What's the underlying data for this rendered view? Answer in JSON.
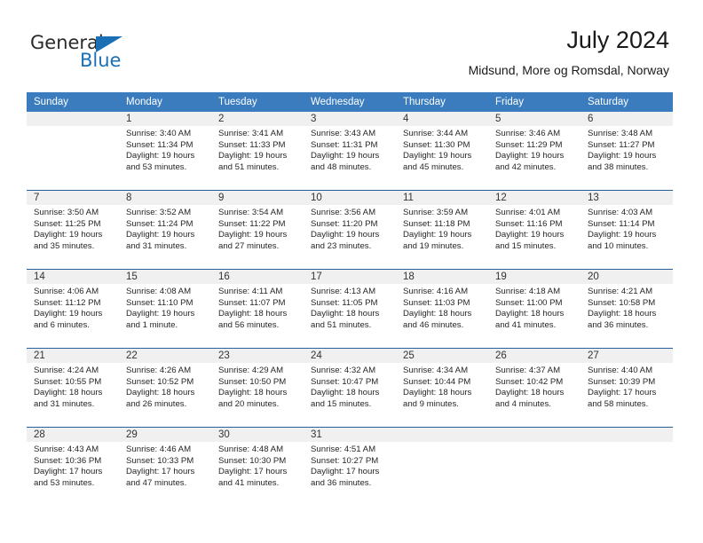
{
  "brand": {
    "name_part1": "General",
    "name_part2": "Blue"
  },
  "header": {
    "title": "July 2024",
    "subtitle": "Midsund, More og Romsdal, Norway"
  },
  "colors": {
    "header_blue": "#3a7cbe",
    "row_rule_blue": "#2a6099",
    "daynum_strip": "#f0f0f0",
    "brand_blue": "#1a6fb5"
  },
  "weekday_headers": [
    "Sunday",
    "Monday",
    "Tuesday",
    "Wednesday",
    "Thursday",
    "Friday",
    "Saturday"
  ],
  "weeks": [
    [
      {
        "day": "",
        "sunrise": "",
        "sunset": "",
        "daylight1": "",
        "daylight2": ""
      },
      {
        "day": "1",
        "sunrise": "Sunrise: 3:40 AM",
        "sunset": "Sunset: 11:34 PM",
        "daylight1": "Daylight: 19 hours",
        "daylight2": "and 53 minutes."
      },
      {
        "day": "2",
        "sunrise": "Sunrise: 3:41 AM",
        "sunset": "Sunset: 11:33 PM",
        "daylight1": "Daylight: 19 hours",
        "daylight2": "and 51 minutes."
      },
      {
        "day": "3",
        "sunrise": "Sunrise: 3:43 AM",
        "sunset": "Sunset: 11:31 PM",
        "daylight1": "Daylight: 19 hours",
        "daylight2": "and 48 minutes."
      },
      {
        "day": "4",
        "sunrise": "Sunrise: 3:44 AM",
        "sunset": "Sunset: 11:30 PM",
        "daylight1": "Daylight: 19 hours",
        "daylight2": "and 45 minutes."
      },
      {
        "day": "5",
        "sunrise": "Sunrise: 3:46 AM",
        "sunset": "Sunset: 11:29 PM",
        "daylight1": "Daylight: 19 hours",
        "daylight2": "and 42 minutes."
      },
      {
        "day": "6",
        "sunrise": "Sunrise: 3:48 AM",
        "sunset": "Sunset: 11:27 PM",
        "daylight1": "Daylight: 19 hours",
        "daylight2": "and 38 minutes."
      }
    ],
    [
      {
        "day": "7",
        "sunrise": "Sunrise: 3:50 AM",
        "sunset": "Sunset: 11:25 PM",
        "daylight1": "Daylight: 19 hours",
        "daylight2": "and 35 minutes."
      },
      {
        "day": "8",
        "sunrise": "Sunrise: 3:52 AM",
        "sunset": "Sunset: 11:24 PM",
        "daylight1": "Daylight: 19 hours",
        "daylight2": "and 31 minutes."
      },
      {
        "day": "9",
        "sunrise": "Sunrise: 3:54 AM",
        "sunset": "Sunset: 11:22 PM",
        "daylight1": "Daylight: 19 hours",
        "daylight2": "and 27 minutes."
      },
      {
        "day": "10",
        "sunrise": "Sunrise: 3:56 AM",
        "sunset": "Sunset: 11:20 PM",
        "daylight1": "Daylight: 19 hours",
        "daylight2": "and 23 minutes."
      },
      {
        "day": "11",
        "sunrise": "Sunrise: 3:59 AM",
        "sunset": "Sunset: 11:18 PM",
        "daylight1": "Daylight: 19 hours",
        "daylight2": "and 19 minutes."
      },
      {
        "day": "12",
        "sunrise": "Sunrise: 4:01 AM",
        "sunset": "Sunset: 11:16 PM",
        "daylight1": "Daylight: 19 hours",
        "daylight2": "and 15 minutes."
      },
      {
        "day": "13",
        "sunrise": "Sunrise: 4:03 AM",
        "sunset": "Sunset: 11:14 PM",
        "daylight1": "Daylight: 19 hours",
        "daylight2": "and 10 minutes."
      }
    ],
    [
      {
        "day": "14",
        "sunrise": "Sunrise: 4:06 AM",
        "sunset": "Sunset: 11:12 PM",
        "daylight1": "Daylight: 19 hours",
        "daylight2": "and 6 minutes."
      },
      {
        "day": "15",
        "sunrise": "Sunrise: 4:08 AM",
        "sunset": "Sunset: 11:10 PM",
        "daylight1": "Daylight: 19 hours",
        "daylight2": "and 1 minute."
      },
      {
        "day": "16",
        "sunrise": "Sunrise: 4:11 AM",
        "sunset": "Sunset: 11:07 PM",
        "daylight1": "Daylight: 18 hours",
        "daylight2": "and 56 minutes."
      },
      {
        "day": "17",
        "sunrise": "Sunrise: 4:13 AM",
        "sunset": "Sunset: 11:05 PM",
        "daylight1": "Daylight: 18 hours",
        "daylight2": "and 51 minutes."
      },
      {
        "day": "18",
        "sunrise": "Sunrise: 4:16 AM",
        "sunset": "Sunset: 11:03 PM",
        "daylight1": "Daylight: 18 hours",
        "daylight2": "and 46 minutes."
      },
      {
        "day": "19",
        "sunrise": "Sunrise: 4:18 AM",
        "sunset": "Sunset: 11:00 PM",
        "daylight1": "Daylight: 18 hours",
        "daylight2": "and 41 minutes."
      },
      {
        "day": "20",
        "sunrise": "Sunrise: 4:21 AM",
        "sunset": "Sunset: 10:58 PM",
        "daylight1": "Daylight: 18 hours",
        "daylight2": "and 36 minutes."
      }
    ],
    [
      {
        "day": "21",
        "sunrise": "Sunrise: 4:24 AM",
        "sunset": "Sunset: 10:55 PM",
        "daylight1": "Daylight: 18 hours",
        "daylight2": "and 31 minutes."
      },
      {
        "day": "22",
        "sunrise": "Sunrise: 4:26 AM",
        "sunset": "Sunset: 10:52 PM",
        "daylight1": "Daylight: 18 hours",
        "daylight2": "and 26 minutes."
      },
      {
        "day": "23",
        "sunrise": "Sunrise: 4:29 AM",
        "sunset": "Sunset: 10:50 PM",
        "daylight1": "Daylight: 18 hours",
        "daylight2": "and 20 minutes."
      },
      {
        "day": "24",
        "sunrise": "Sunrise: 4:32 AM",
        "sunset": "Sunset: 10:47 PM",
        "daylight1": "Daylight: 18 hours",
        "daylight2": "and 15 minutes."
      },
      {
        "day": "25",
        "sunrise": "Sunrise: 4:34 AM",
        "sunset": "Sunset: 10:44 PM",
        "daylight1": "Daylight: 18 hours",
        "daylight2": "and 9 minutes."
      },
      {
        "day": "26",
        "sunrise": "Sunrise: 4:37 AM",
        "sunset": "Sunset: 10:42 PM",
        "daylight1": "Daylight: 18 hours",
        "daylight2": "and 4 minutes."
      },
      {
        "day": "27",
        "sunrise": "Sunrise: 4:40 AM",
        "sunset": "Sunset: 10:39 PM",
        "daylight1": "Daylight: 17 hours",
        "daylight2": "and 58 minutes."
      }
    ],
    [
      {
        "day": "28",
        "sunrise": "Sunrise: 4:43 AM",
        "sunset": "Sunset: 10:36 PM",
        "daylight1": "Daylight: 17 hours",
        "daylight2": "and 53 minutes."
      },
      {
        "day": "29",
        "sunrise": "Sunrise: 4:46 AM",
        "sunset": "Sunset: 10:33 PM",
        "daylight1": "Daylight: 17 hours",
        "daylight2": "and 47 minutes."
      },
      {
        "day": "30",
        "sunrise": "Sunrise: 4:48 AM",
        "sunset": "Sunset: 10:30 PM",
        "daylight1": "Daylight: 17 hours",
        "daylight2": "and 41 minutes."
      },
      {
        "day": "31",
        "sunrise": "Sunrise: 4:51 AM",
        "sunset": "Sunset: 10:27 PM",
        "daylight1": "Daylight: 17 hours",
        "daylight2": "and 36 minutes."
      },
      {
        "day": "",
        "sunrise": "",
        "sunset": "",
        "daylight1": "",
        "daylight2": ""
      },
      {
        "day": "",
        "sunrise": "",
        "sunset": "",
        "daylight1": "",
        "daylight2": ""
      },
      {
        "day": "",
        "sunrise": "",
        "sunset": "",
        "daylight1": "",
        "daylight2": ""
      }
    ]
  ]
}
